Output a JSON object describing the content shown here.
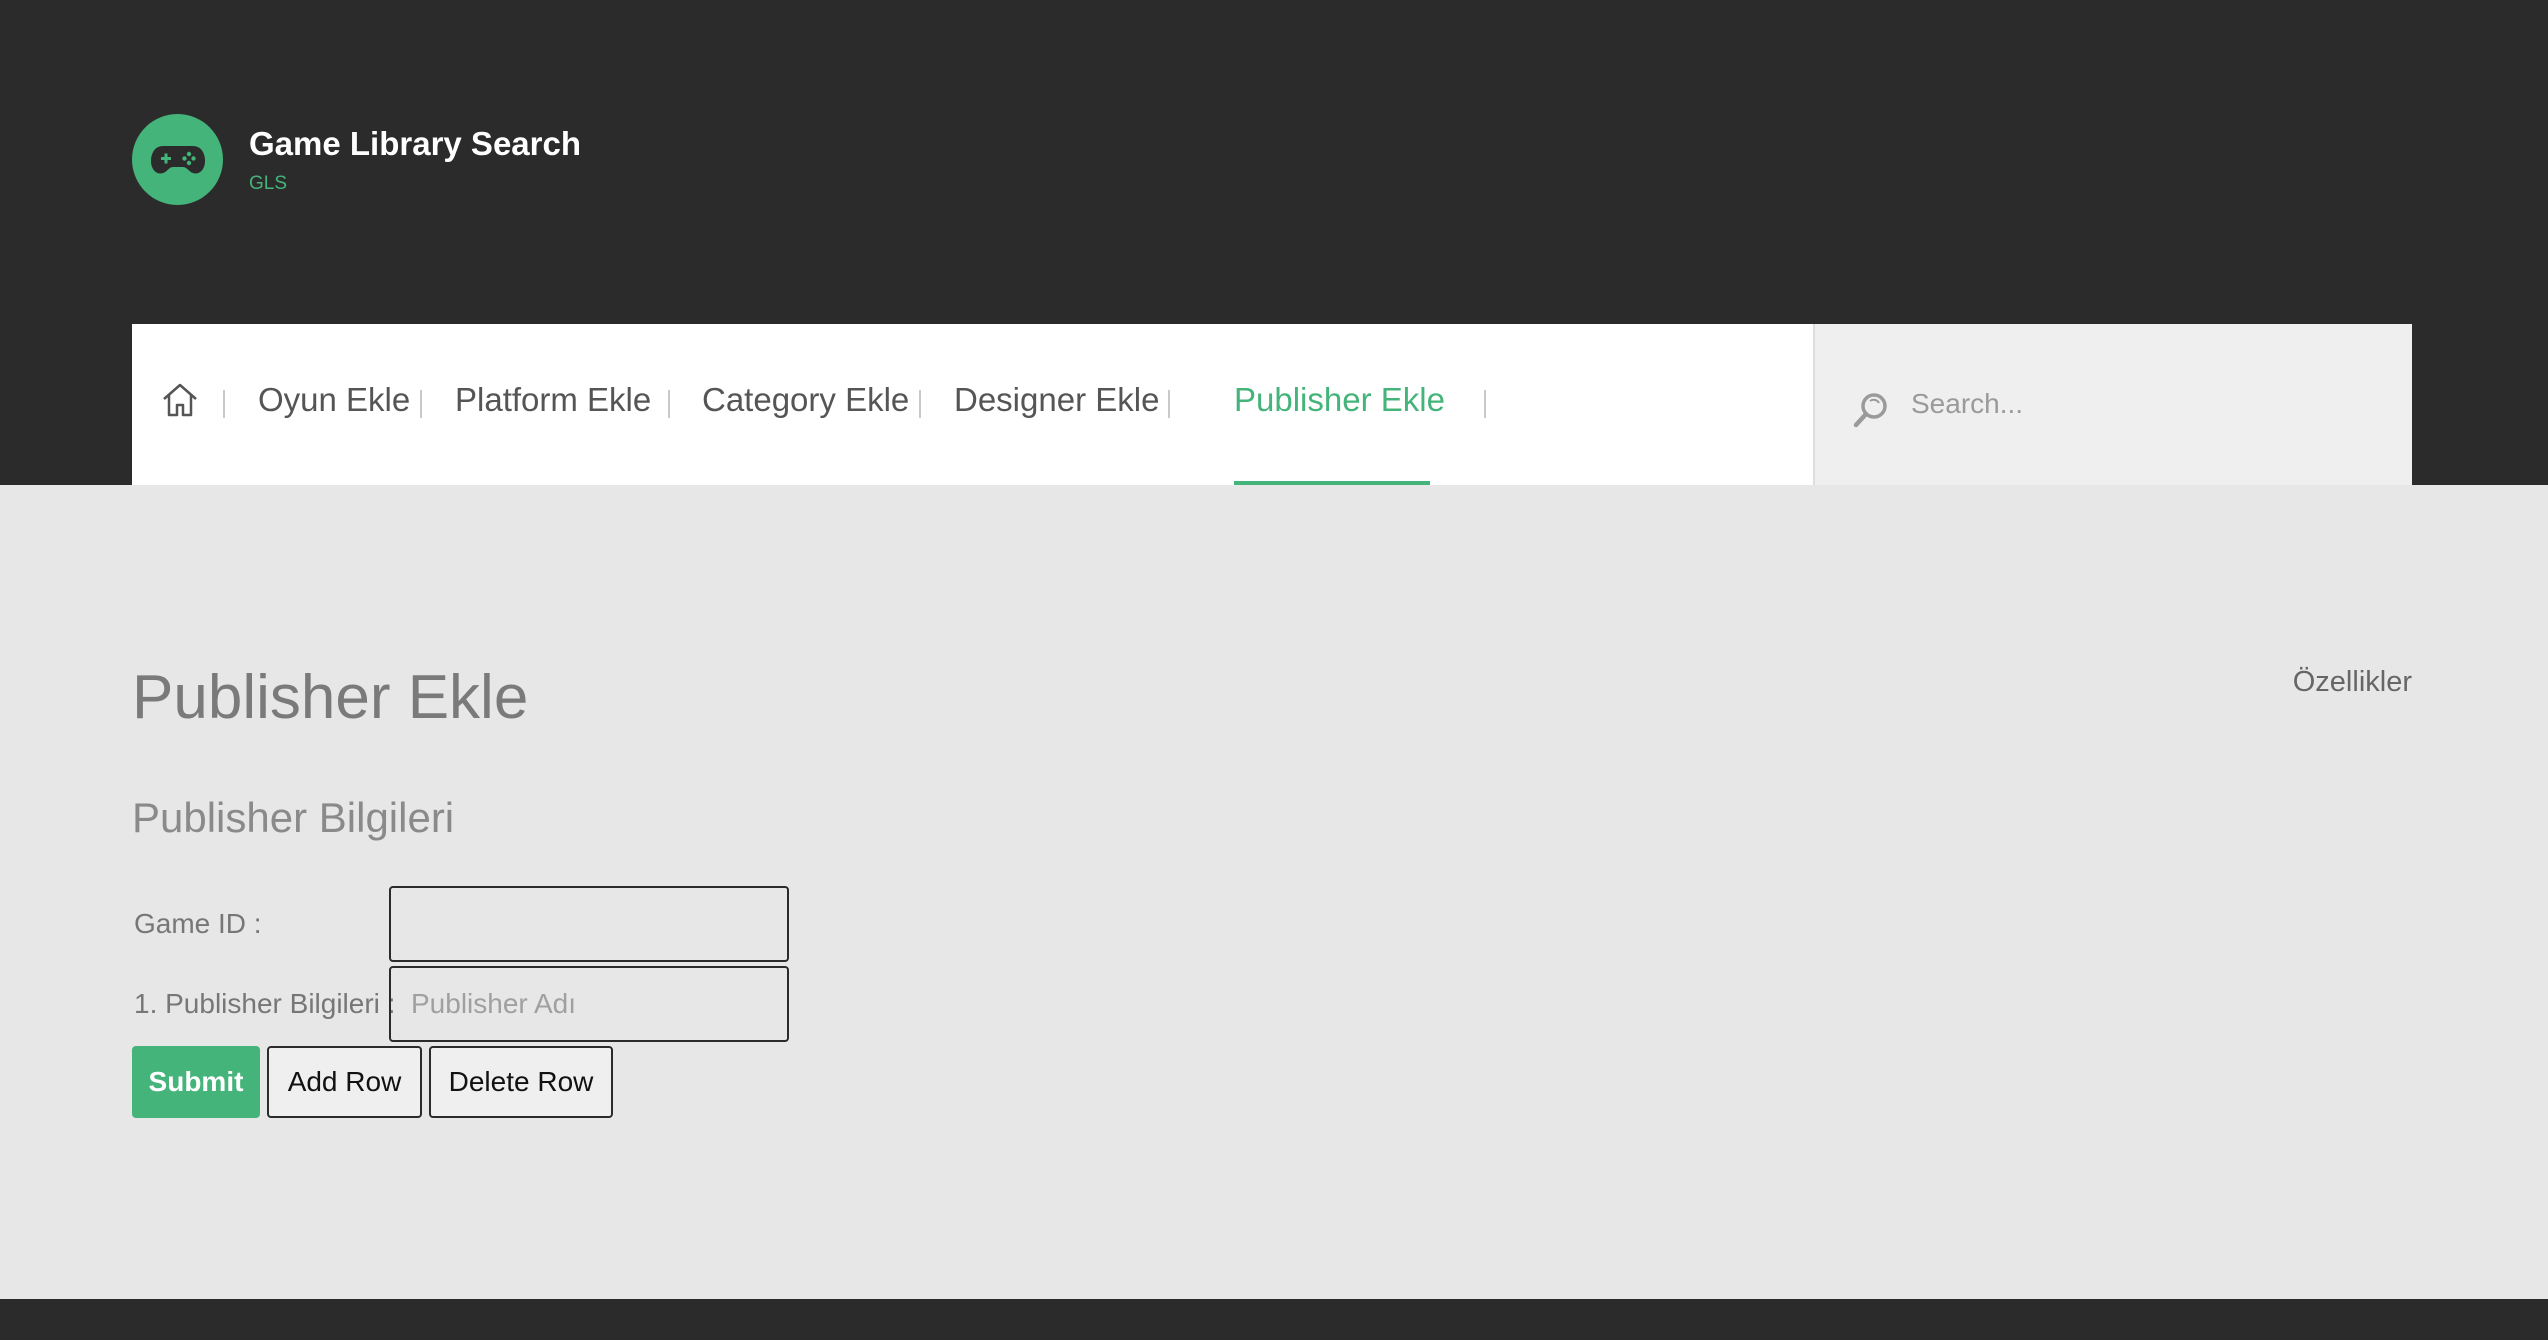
{
  "header": {
    "site_title": "Game Library Search",
    "site_subtitle": "GLS",
    "logo_icon": "gamepad-icon",
    "brand_color": "#45b47a",
    "background_color": "#2b2b2b"
  },
  "nav": {
    "home_icon": "home-icon",
    "items": [
      {
        "label": "Oyun Ekle",
        "active": false
      },
      {
        "label": "Platform Ekle",
        "active": false
      },
      {
        "label": "Category Ekle",
        "active": false
      },
      {
        "label": "Designer Ekle",
        "active": false
      },
      {
        "label": "Publisher Ekle",
        "active": true
      }
    ],
    "search": {
      "placeholder": "Search...",
      "icon": "search-icon"
    }
  },
  "main": {
    "page_title": "Publisher Ekle",
    "features_link": "Özellikler",
    "section_title": "Publisher Bilgileri",
    "fields": [
      {
        "label": "Game ID :",
        "value": "",
        "placeholder": ""
      },
      {
        "label": "1. Publisher Bilgileri :",
        "value": "",
        "placeholder": "Publisher Adı"
      }
    ],
    "buttons": {
      "submit": "Submit",
      "add_row": "Add Row",
      "delete_row": "Delete Row"
    }
  }
}
